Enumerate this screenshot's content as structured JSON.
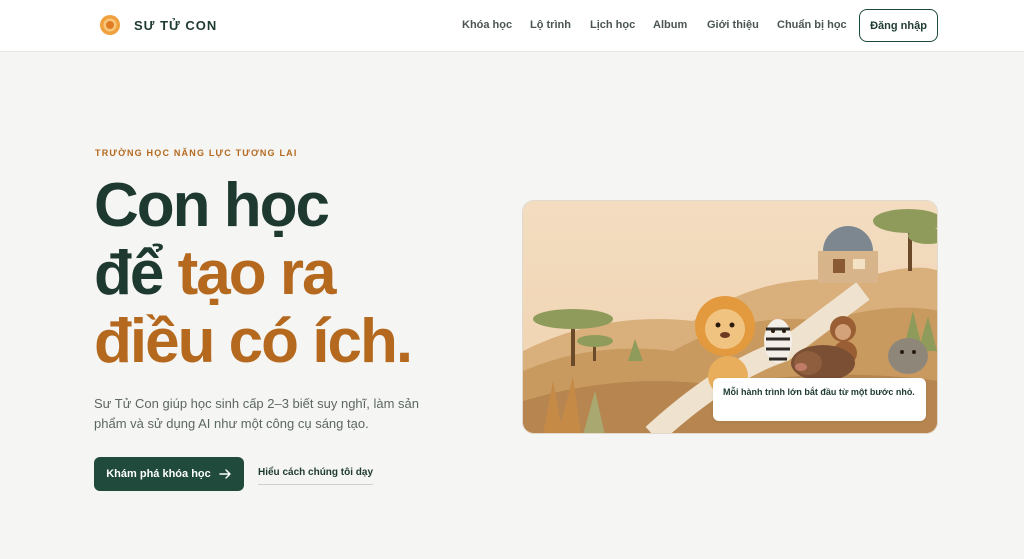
{
  "brand": {
    "name": "SƯ TỬ CON",
    "logo_icon": "sun-logo-icon",
    "accent": "#e89a3c"
  },
  "nav": {
    "items": [
      "Khóa học",
      "Lộ trình",
      "Lịch học",
      "Album",
      "Giới thiệu",
      "Chuẩn bị học"
    ],
    "login_label": "Đăng nhập"
  },
  "hero": {
    "eyebrow": "TRƯỜNG HỌC NĂNG LỰC TƯƠNG LAI",
    "headline_line1": "Con học",
    "headline_line2_a": "để ",
    "headline_line2_b": "tạo ra",
    "headline_line3": "điều có ích.",
    "description": "Sư Tử Con giúp học sinh cấp 2–3 biết suy nghĩ, làm sản phẩm và sử dụng AI như một công cụ sáng tạo.",
    "cta_label": "Khám phá khóa học",
    "cta_icon": "arrow-right-icon",
    "secondary_link": "Hiểu cách chúng tôi dạy",
    "image_caption": "Mỗi hành trình lớn bắt đầu từ một bước nhỏ.",
    "colors": {
      "primary": "#1e3a30",
      "accent": "#b4691f",
      "button": "#1f4a3c"
    }
  }
}
